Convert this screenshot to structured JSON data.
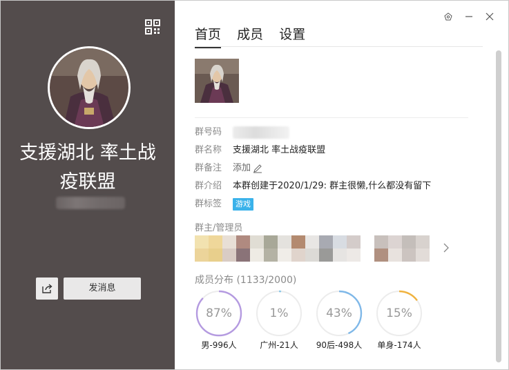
{
  "group": {
    "name": "支援湖北 率土战疫联盟",
    "name_line1": "支援湖北 率土战",
    "name_line2": "疫联盟"
  },
  "left_panel": {
    "qr_icon": "qr-code-icon",
    "share_icon": "share-icon",
    "send_message_label": "发消息"
  },
  "window_controls": {
    "skin_icon": "skin-icon",
    "minimize_icon": "minimize-icon",
    "close_icon": "close-icon"
  },
  "tabs": [
    {
      "label": "首页",
      "active": true
    },
    {
      "label": "成员",
      "active": false
    },
    {
      "label": "设置",
      "active": false
    }
  ],
  "info": {
    "group_number_label": "群号码",
    "group_name_label": "群名称",
    "group_name_value": "支援湖北 率土战疫联盟",
    "remark_label": "群备注",
    "remark_action": "添加",
    "intro_label": "群介绍",
    "intro_value": "本群创建于2020/1/29: 群主很懒,什么都没有留下",
    "tags_label": "群标签",
    "tag_value": "游戏"
  },
  "admins": {
    "label": "群主/管理员"
  },
  "distribution": {
    "label": "成员分布",
    "count": "(1133/2000)",
    "items": [
      {
        "percent": "87%",
        "value": 87,
        "caption": "男-996人",
        "color": "#b49ae0"
      },
      {
        "percent": "1%",
        "value": 1,
        "caption": "广州-21人",
        "color": "#8cc8e8"
      },
      {
        "percent": "43%",
        "value": 43,
        "caption": "90后-498人",
        "color": "#7fb8e8"
      },
      {
        "percent": "15%",
        "value": 15,
        "caption": "单身-174人",
        "color": "#f0b340"
      }
    ]
  },
  "colors": {
    "left_panel_bg": "#534c4c",
    "tag_bg": "#3ab2ea"
  }
}
